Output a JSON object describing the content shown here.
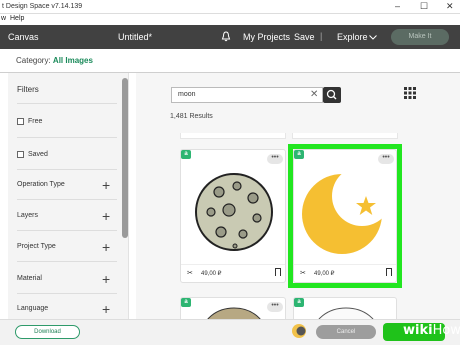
{
  "window": {
    "title": "t Design Space  v7.14.139",
    "minimize": "–",
    "maximize": "☐",
    "close": "✕"
  },
  "menubar": {
    "items": [
      "w",
      "Help"
    ]
  },
  "topbar": {
    "canvas": "Canvas",
    "doc_title": "Untitled*",
    "my_projects": "My Projects",
    "save": "Save",
    "sep": "|",
    "explore": "Explore",
    "make_it": "Make It"
  },
  "category": {
    "label": "Category:",
    "value": "All Images"
  },
  "filters": {
    "title": "Filters",
    "checkboxes": [
      "Free",
      "Saved"
    ],
    "rows": [
      "Operation Type",
      "Layers",
      "Project Type",
      "Material",
      "Language"
    ]
  },
  "search": {
    "value": "moon",
    "clear": "✕"
  },
  "results": "1,481 Results",
  "cards": [
    {
      "badge": "a",
      "more": "•••",
      "price": "49,00 ₽",
      "icon": "moon-craters-image"
    },
    {
      "badge": "a",
      "more": "•••",
      "price": "49,00 ₽",
      "icon": "crescent-moon-star-image"
    },
    {
      "badge": "a",
      "more": "•••",
      "icon": "partial-moon-image"
    },
    {
      "badge": "a",
      "more": "",
      "icon": "partial-moon-outline-image"
    }
  ],
  "footer": {
    "download": "Download",
    "cancel": "Cancel"
  },
  "watermark": {
    "bold": "wiki",
    "light": "How"
  },
  "colors": {
    "accent": "#22e620",
    "brand_green": "#1a8a5a",
    "topbar": "#414141"
  }
}
